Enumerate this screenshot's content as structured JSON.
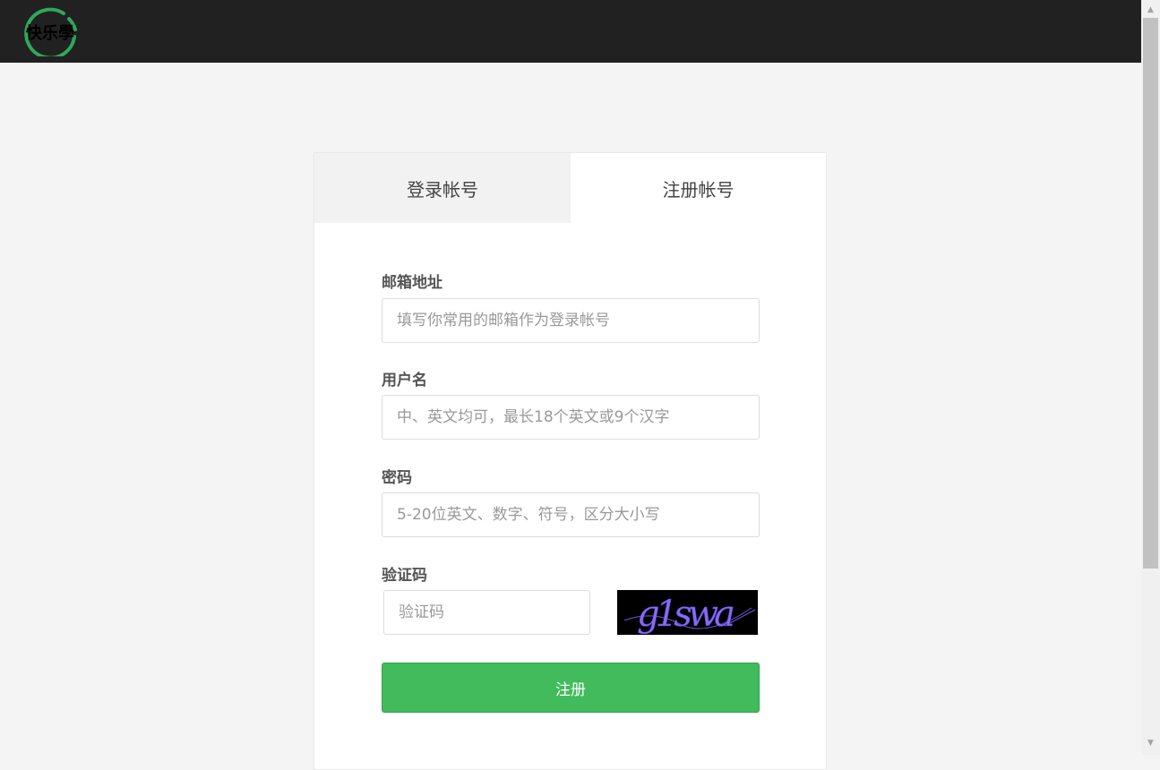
{
  "header": {
    "logo_icon": "kuai-xue-logo-icon",
    "logo_text": "快乐學"
  },
  "tabs": [
    {
      "label": "登录帐号",
      "active": false
    },
    {
      "label": "注册帐号",
      "active": true
    }
  ],
  "form": {
    "email": {
      "label": "邮箱地址",
      "placeholder": "填写你常用的邮箱作为登录帐号"
    },
    "username": {
      "label": "用户名",
      "placeholder": "中、英文均可，最长18个英文或9个汉字"
    },
    "password": {
      "label": "密码",
      "placeholder": "5-20位英文、数字、符号，区分大小写"
    },
    "captcha": {
      "label": "验证码",
      "placeholder": "验证码",
      "image_text": "g1swa"
    },
    "submit_label": "注册"
  },
  "colors": {
    "topbar": "#212121",
    "accent": "#41bb5c",
    "logo_ring": "#2ea85a",
    "captcha_text": "#8a6cf0"
  }
}
